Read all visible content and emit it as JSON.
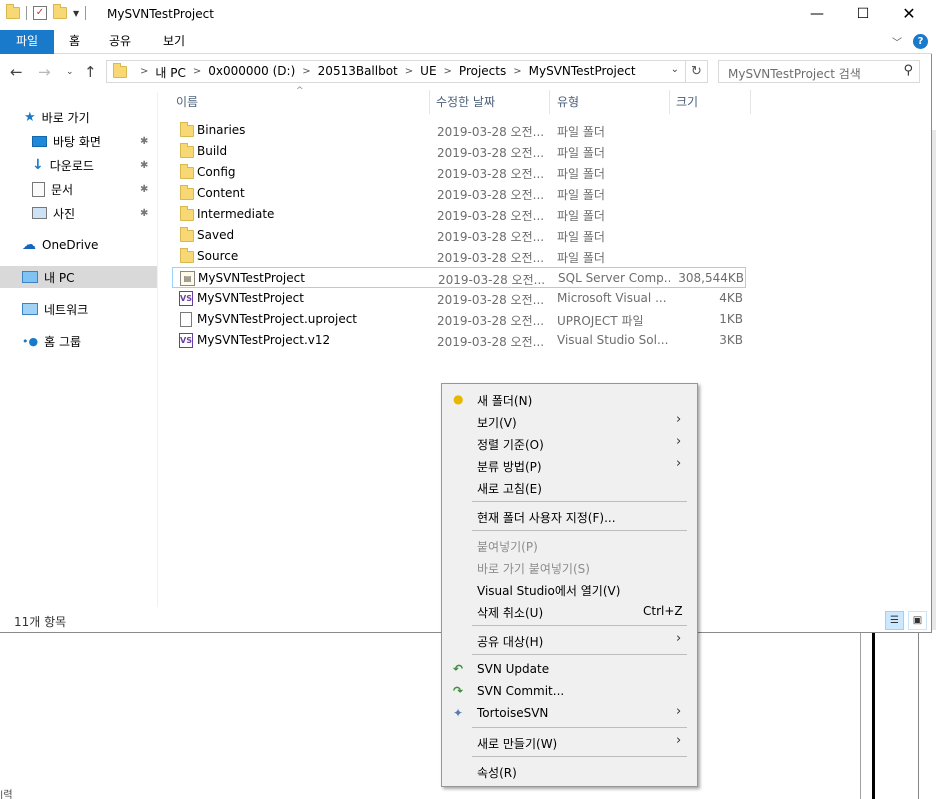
{
  "window": {
    "title": "MySVNTestProject",
    "minimize": "—",
    "maximize": "☐",
    "close": "✕"
  },
  "ribbon": {
    "tabs": [
      "파일",
      "홈",
      "공유",
      "보기"
    ],
    "help": "?"
  },
  "address": {
    "crumbs": [
      "내 PC",
      "0x000000 (D:)",
      "20513Ballbot",
      "UE",
      "Projects",
      "MySVNTestProject"
    ],
    "search_placeholder": "MySVNTestProject 검색"
  },
  "sidebar": {
    "quick_access": "바로 가기",
    "pinned": [
      "바탕 화면",
      "다운로드",
      "문서",
      "사진"
    ],
    "onedrive": "OneDrive",
    "this_pc": "내 PC",
    "network": "네트워크",
    "homegroup": "홈 그룹"
  },
  "columns": {
    "name": "이름",
    "date": "수정한 날짜",
    "type": "유형",
    "size": "크기"
  },
  "files": [
    {
      "name": "Binaries",
      "date": "2019-03-28 오전...",
      "type": "파일 폴더",
      "size": "",
      "icon": "folder"
    },
    {
      "name": "Build",
      "date": "2019-03-28 오전...",
      "type": "파일 폴더",
      "size": "",
      "icon": "folder"
    },
    {
      "name": "Config",
      "date": "2019-03-28 오전...",
      "type": "파일 폴더",
      "size": "",
      "icon": "folder"
    },
    {
      "name": "Content",
      "date": "2019-03-28 오전...",
      "type": "파일 폴더",
      "size": "",
      "icon": "folder"
    },
    {
      "name": "Intermediate",
      "date": "2019-03-28 오전...",
      "type": "파일 폴더",
      "size": "",
      "icon": "folder"
    },
    {
      "name": "Saved",
      "date": "2019-03-28 오전...",
      "type": "파일 폴더",
      "size": "",
      "icon": "folder"
    },
    {
      "name": "Source",
      "date": "2019-03-28 오전...",
      "type": "파일 폴더",
      "size": "",
      "icon": "folder"
    },
    {
      "name": "MySVNTestProject",
      "date": "2019-03-28 오전...",
      "type": "SQL Server Comp...",
      "size": "308,544KB",
      "icon": "sql-database"
    },
    {
      "name": "MySVNTestProject",
      "date": "2019-03-28 오전...",
      "type": "Microsoft Visual ...",
      "size": "4KB",
      "icon": "visual-studio"
    },
    {
      "name": "MySVNTestProject.uproject",
      "date": "2019-03-28 오전...",
      "type": "UPROJECT 파일",
      "size": "1KB",
      "icon": "file"
    },
    {
      "name": "MySVNTestProject.v12",
      "date": "2019-03-28 오전...",
      "type": "Visual Studio Sol...",
      "size": "3KB",
      "icon": "visual-studio"
    }
  ],
  "status": {
    "count": "11개 항목"
  },
  "context_menu": {
    "new_folder": "새 폴더(N)",
    "view": "보기(V)",
    "sort_by": "정렬 기준(O)",
    "group_by": "분류 방법(P)",
    "refresh": "새로 고침(E)",
    "customize": "현재 폴더 사용자 지정(F)...",
    "paste": "붙여넣기(P)",
    "paste_shortcut": "바로 가기 붙여넣기(S)",
    "open_vs": "Visual Studio에서 열기(V)",
    "undo_delete": "삭제 취소(U)",
    "undo_shortcut": "Ctrl+Z",
    "share_with": "공유 대상(H)",
    "svn_update": "SVN Update",
    "svn_commit": "SVN Commit...",
    "tortoise": "TortoiseSVN",
    "new": "새로 만들기(W)",
    "properties": "속성(R)"
  },
  "background": {
    "bottom_fragment": "|력"
  },
  "colors": {
    "accent": "#1979ca",
    "folder": "#f8d775",
    "selection_border": "#99d1ff",
    "header_text": "#4c607a"
  }
}
